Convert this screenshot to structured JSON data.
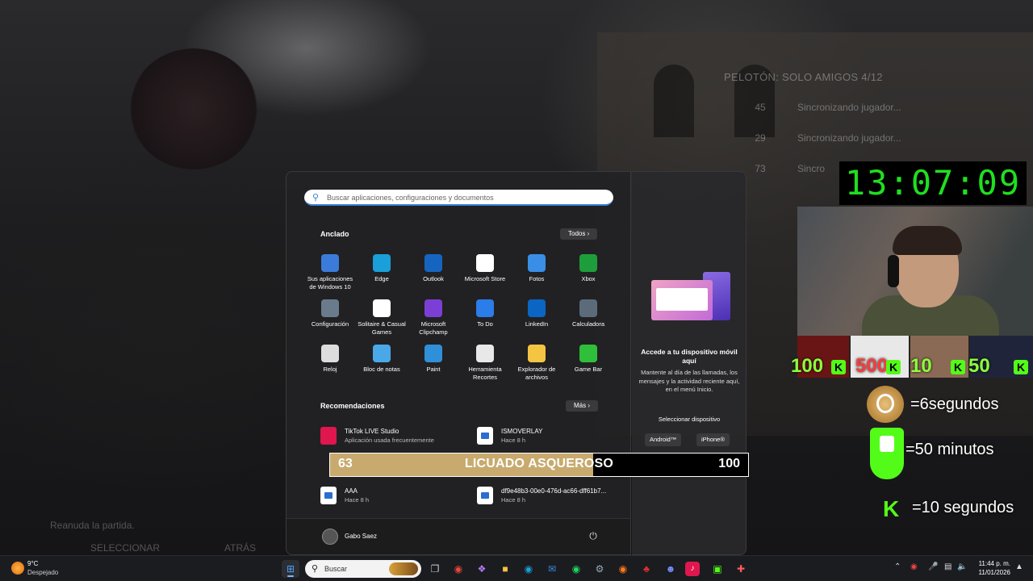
{
  "game": {
    "lobby_title": "PELOTÓN: SOLO AMIGOS 4/12",
    "players": [
      {
        "num": "45",
        "status": "Sincronizando jugador..."
      },
      {
        "num": "29",
        "status": "Sincronizando jugador..."
      },
      {
        "num": "73",
        "status": "Sincro"
      }
    ],
    "hint_resume": "Reanuda la partida.",
    "hint_select": "SELECCIONAR",
    "hint_back": "ATRÁS"
  },
  "stream": {
    "clock": "13:07:09",
    "thumb_values": [
      "100",
      "500",
      "10",
      "50"
    ],
    "thumb_k": "K",
    "rewards": [
      {
        "label": "=6segundos"
      },
      {
        "label": "=50 minutos"
      },
      {
        "label": "=10 segundos"
      }
    ],
    "progress": {
      "current": "63",
      "title": "LICUADO ASQUEROSO",
      "max": "100",
      "fraction": 0.63
    }
  },
  "start_menu": {
    "search_placeholder": "Buscar aplicaciones, configuraciones y documentos",
    "pinned_title": "Anclado",
    "all_label": "Todos",
    "apps": [
      {
        "label": "Sus aplicaciones de Windows 10",
        "icon": "apps-grid-icon",
        "color": "#3b7bd9"
      },
      {
        "label": "Edge",
        "icon": "edge-icon",
        "color": "#1a9fd9"
      },
      {
        "label": "Outlook",
        "icon": "outlook-icon",
        "color": "#1565c0"
      },
      {
        "label": "Microsoft Store",
        "icon": "store-icon",
        "color": "#ffffff"
      },
      {
        "label": "Fotos",
        "icon": "photos-icon",
        "color": "#3a8ee6"
      },
      {
        "label": "Xbox",
        "icon": "xbox-icon",
        "color": "#1e9e3a"
      },
      {
        "label": "Configuración",
        "icon": "settings-icon",
        "color": "#6a7b8c"
      },
      {
        "label": "Solitaire & Casual Games",
        "icon": "cards-icon",
        "color": "#ffffff"
      },
      {
        "label": "Microsoft Clipchamp",
        "icon": "clipchamp-icon",
        "color": "#7b3fd6"
      },
      {
        "label": "To Do",
        "icon": "todo-icon",
        "color": "#2b7de9"
      },
      {
        "label": "LinkedIn",
        "icon": "linkedin-icon",
        "color": "#0a66c2"
      },
      {
        "label": "Calculadora",
        "icon": "calculator-icon",
        "color": "#5b6b7a"
      },
      {
        "label": "Reloj",
        "icon": "clock-icon",
        "color": "#dddddd"
      },
      {
        "label": "Bloc de notas",
        "icon": "notepad-icon",
        "color": "#4aa8e8"
      },
      {
        "label": "Paint",
        "icon": "paint-icon",
        "color": "#2f8fd8"
      },
      {
        "label": "Herramienta Recortes",
        "icon": "snipping-icon",
        "color": "#e8e8e8"
      },
      {
        "label": "Explorador de archivos",
        "icon": "folder-icon",
        "color": "#f4c542"
      },
      {
        "label": "Game Bar",
        "icon": "gamebar-icon",
        "color": "#2fbf3a"
      }
    ],
    "rec_title": "Recomendaciones",
    "more_label": "Más",
    "recommendations": [
      {
        "name": "TikTok LIVE Studio",
        "sub": "Aplicación usada frecuentemente",
        "icon": "tiktok-icon"
      },
      {
        "name": "ISMOVERLAY",
        "sub": "Hace 8 h",
        "icon": "document-icon"
      },
      {
        "name": "AAA",
        "sub": "Hace 8 h",
        "icon": "document-icon"
      },
      {
        "name": "df9e48b3-00e0-476d-ac66-dff61b7...",
        "sub": "Hace 8 h",
        "icon": "document-icon"
      }
    ],
    "user_name": "Gabo Saez",
    "phone_panel": {
      "title": "Accede a tu dispositivo móvil aquí",
      "body": "Mantente al día de las llamadas, los mensajes y la actividad reciente aquí, en el menú Inicio.",
      "select_label": "Seleccionar dispositivo",
      "android_label": "Android™",
      "iphone_label": "iPhone®"
    }
  },
  "taskbar": {
    "weather_temp": "9°C",
    "weather_desc": "Despejado",
    "search_label": "Buscar",
    "time": "11:44 p. m.",
    "date": "11/01/2026"
  }
}
